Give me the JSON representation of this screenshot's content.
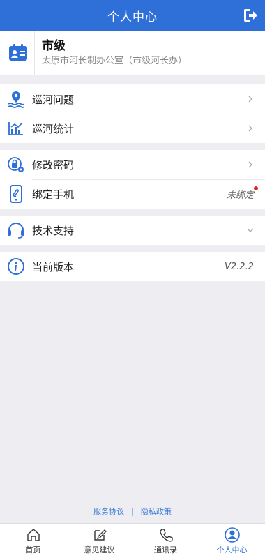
{
  "header": {
    "title": "个人中心"
  },
  "profile": {
    "name": "市级",
    "org": "太原市河长制办公室（市级河长办）"
  },
  "groups": [
    {
      "items": [
        {
          "label": "巡河问题",
          "icon": "location-wave-icon"
        },
        {
          "label": "巡河统计",
          "icon": "statistics-chart-icon"
        }
      ]
    },
    {
      "items": [
        {
          "label": "修改密码",
          "icon": "lock-settings-icon"
        },
        {
          "label": "绑定手机",
          "icon": "phone-icon",
          "status": "未绑定"
        }
      ]
    },
    {
      "items": [
        {
          "label": "技术支持",
          "icon": "headset-icon"
        }
      ]
    },
    {
      "items": [
        {
          "label": "当前版本",
          "icon": "info-icon",
          "value": "V2.2.2"
        }
      ]
    }
  ],
  "footer": {
    "service_agreement": "服务协议",
    "separator": "|",
    "privacy_policy": "隐私政策"
  },
  "tabbar": {
    "tabs": [
      {
        "label": "首页",
        "icon": "home-icon"
      },
      {
        "label": "意见建议",
        "icon": "edit-icon"
      },
      {
        "label": "通讯录",
        "icon": "phone-handset-icon"
      },
      {
        "label": "个人中心",
        "icon": "user-icon",
        "active": true
      }
    ]
  },
  "colors": {
    "primary": "#2f6fd8",
    "badge": "#e5202e",
    "link": "#3a7ad9"
  }
}
